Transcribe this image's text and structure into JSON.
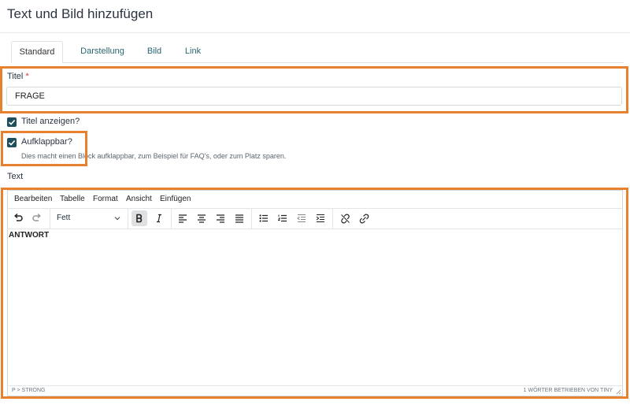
{
  "page": {
    "title": "Text und Bild hinzufügen"
  },
  "tabs": [
    {
      "label": "Standard",
      "active": true
    },
    {
      "label": "Darstellung",
      "active": false
    },
    {
      "label": "Bild",
      "active": false
    },
    {
      "label": "Link",
      "active": false
    }
  ],
  "title_field": {
    "label": "Titel",
    "required_mark": "*",
    "value": "FRAGE"
  },
  "show_title": {
    "label": "Titel anzeigen?",
    "checked": true
  },
  "collapsible": {
    "label": "Aufklappbar?",
    "checked": true,
    "help": "Dies macht einen Block aufklappbar, zum Beispiel für FAQ's, oder zum Platz sparen."
  },
  "text_field": {
    "label": "Text"
  },
  "editor": {
    "menu": [
      "Bearbeiten",
      "Tabelle",
      "Format",
      "Ansicht",
      "Einfügen"
    ],
    "format_select": "Fett",
    "content": "ANTWORT",
    "status_path": "P > STRONG",
    "word_count": "1 WÖRTER",
    "powered_by": "BETRIEBEN VON TINY"
  },
  "colors": {
    "highlight": "#e5812f",
    "checkbox": "#1f4f5a",
    "tab_link": "#2a6470"
  }
}
